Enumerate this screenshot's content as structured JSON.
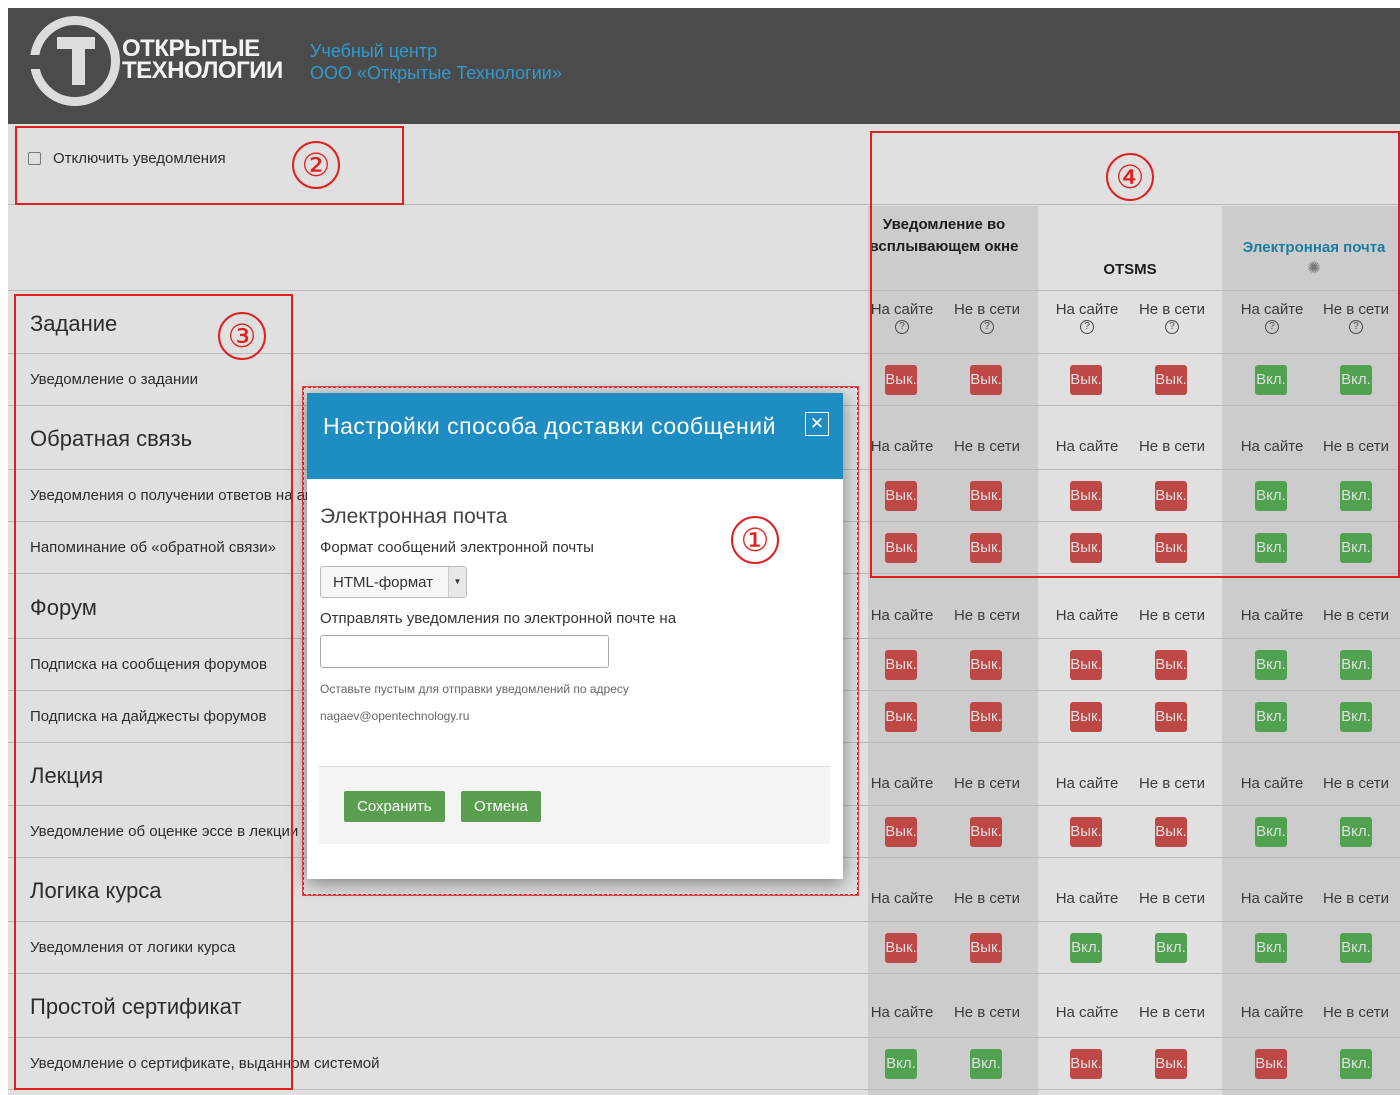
{
  "header": {
    "logo_line1": "ОТКРЫТЫЕ",
    "logo_line2": "ТЕХНОЛОГИИ",
    "org_line1": "Учебный центр",
    "org_line2": "ООО «Открытые Технологии»"
  },
  "disable_notifications_label": "Отключить уведомления",
  "columns": {
    "popup": "Уведомление во всплывающем окне",
    "otsms": "OTSMS",
    "email": "Электронная почта",
    "on_site": "На сайте",
    "offline": "Не в сети",
    "on_label": "Вкл.",
    "off_label": "Вык."
  },
  "categories": [
    {
      "title": "Задание",
      "items": [
        {
          "label": "Уведомление о задании",
          "states": [
            "off",
            "off",
            "off",
            "off",
            "on",
            "on"
          ]
        }
      ]
    },
    {
      "title": "Обратная связь",
      "items": [
        {
          "label": "Уведомления о получении ответов на анкету",
          "states": [
            "off",
            "off",
            "off",
            "off",
            "on",
            "on"
          ]
        },
        {
          "label": "Напоминание об «обратной связи»",
          "states": [
            "off",
            "off",
            "off",
            "off",
            "on",
            "on"
          ]
        }
      ]
    },
    {
      "title": "Форум",
      "items": [
        {
          "label": "Подписка на сообщения форумов",
          "states": [
            "off",
            "off",
            "off",
            "off",
            "on",
            "on"
          ]
        },
        {
          "label": "Подписка на дайджесты форумов",
          "states": [
            "off",
            "off",
            "off",
            "off",
            "on",
            "on"
          ]
        }
      ]
    },
    {
      "title": "Лекция",
      "items": [
        {
          "label": "Уведомление об оценке эссе в лекции",
          "states": [
            "off",
            "off",
            "off",
            "off",
            "on",
            "on"
          ]
        }
      ]
    },
    {
      "title": "Логика курса",
      "items": [
        {
          "label": "Уведомления от логики курса",
          "states": [
            "off",
            "off",
            "on",
            "on",
            "on",
            "on"
          ]
        }
      ]
    },
    {
      "title": "Простой сертификат",
      "items": [
        {
          "label": "Уведомление о сертификате, выданном системой",
          "states": [
            "on",
            "on",
            "off",
            "off",
            "off",
            "on"
          ]
        }
      ]
    }
  ],
  "modal": {
    "title": "Настройки способа доставки сообщений",
    "section": "Электронная почта",
    "format_label": "Формат сообщений электронной почты",
    "format_value": "HTML-формат",
    "send_label": "Отправлять уведомления по электронной почте на",
    "hint_line1": "Оставьте пустым для отправки уведомлений по адресу",
    "hint_line2": "nagaev@opentechnology.ru",
    "save": "Сохранить",
    "cancel": "Отмена"
  },
  "annotations": [
    "①",
    "②",
    "③",
    "④"
  ],
  "colors": {
    "header_bg": "#4b4b4b",
    "accent_blue": "#1e8ec2",
    "on_green": "#5cb85c",
    "off_red": "#d9534f",
    "annotation_red": "#e0201f"
  }
}
